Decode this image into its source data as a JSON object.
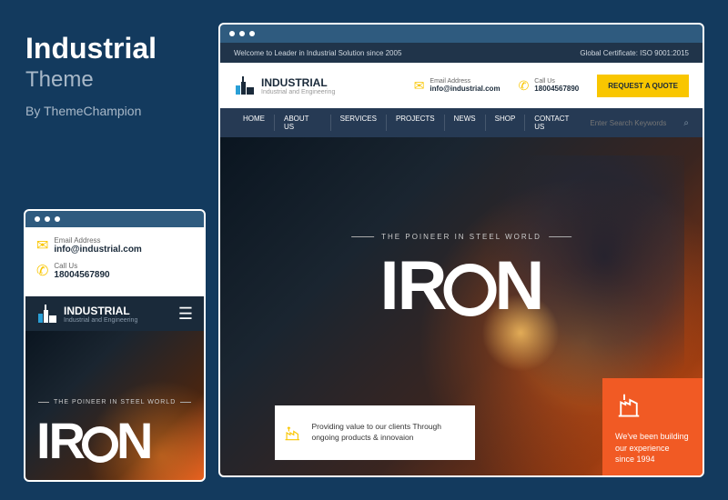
{
  "promo": {
    "title": "Industrial",
    "subtitle": "Theme",
    "by": "By ThemeChampion"
  },
  "topbar": {
    "welcome": "Welcome to Leader in Industrial Solution since 2005",
    "certificate": "Global Certificate: ISO 9001:2015"
  },
  "brand": {
    "name": "INDUSTRIAL",
    "tagline": "Industrial and Engineering"
  },
  "contacts": {
    "email": {
      "label": "Email Address",
      "value": "info@industrial.com"
    },
    "phone": {
      "label": "Call Us",
      "value": "18004567890"
    }
  },
  "cta": {
    "quote": "REQUEST A QUOTE"
  },
  "nav": {
    "items": [
      "HOME",
      "ABOUT US",
      "SERVICES",
      "PROJECTS",
      "NEWS",
      "SHOP",
      "CONTACT US"
    ],
    "search_placeholder": "Enter Search Keywords"
  },
  "hero": {
    "tagline": "THE POINEER IN STEEL WORLD",
    "big_pre": "IR",
    "big_post": "N"
  },
  "value_card": {
    "text": "Providing value to our clients Through ongoing products & innovaion"
  },
  "exp_card": {
    "text": "We've been building our experience since 1994"
  }
}
